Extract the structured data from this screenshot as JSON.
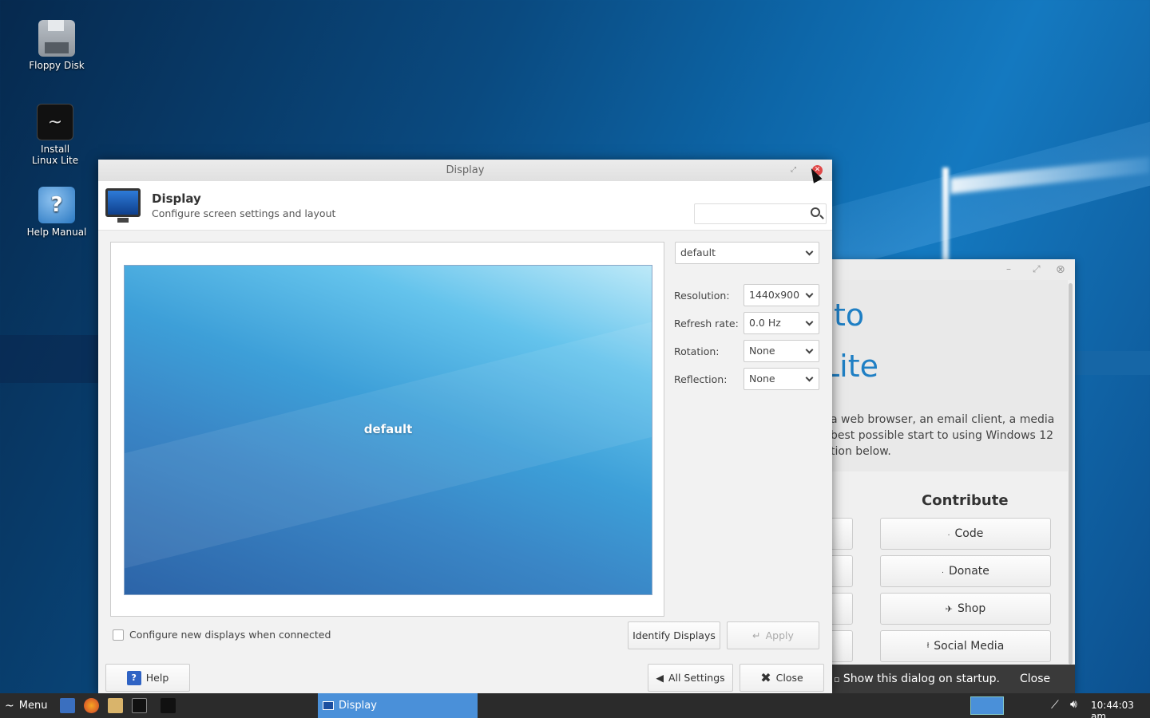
{
  "desktop": {
    "icons": [
      {
        "label": "Floppy Disk"
      },
      {
        "label": "Install Linux Lite"
      },
      {
        "label": "Help Manual"
      }
    ]
  },
  "display_window": {
    "title": "Display",
    "header_title": "Display",
    "header_subtitle": "Configure screen settings and layout",
    "search_placeholder": "",
    "output_select": "default",
    "preview_label": "default",
    "properties": {
      "resolution_label": "Resolution:",
      "resolution_value": "1440x900",
      "refresh_label": "Refresh rate:",
      "refresh_value": "0.0 Hz",
      "rotation_label": "Rotation:",
      "rotation_value": "None",
      "reflection_label": "Reflection:",
      "reflection_value": "None"
    },
    "configure_checkbox_label": "Configure new displays when connected",
    "configure_checked": false,
    "identify_button": "Identify Displays",
    "apply_button": "Apply",
    "help_button": "Help",
    "all_settings_button": "All Settings",
    "close_button": "Close"
  },
  "welcome_window": {
    "hero_line1": "to",
    "hero_line2": "Lite",
    "hero_paragraph": "a web browser, an email client, a media best possible start to using Windows 12 tion below.",
    "contribute_heading": "Contribute",
    "buttons": {
      "code": "Code",
      "donate": "Donate",
      "shop": "Shop",
      "social": "Social Media"
    },
    "show_on_startup": "Show this dialog on startup.",
    "close": "Close"
  },
  "taskbar": {
    "menu_label": "Menu",
    "active_task": "Display",
    "clock": "10:44:03 am"
  },
  "colors": {
    "accent": "#4a90d9",
    "close_red": "#e04848",
    "brand_blue": "#1f7fc4"
  }
}
